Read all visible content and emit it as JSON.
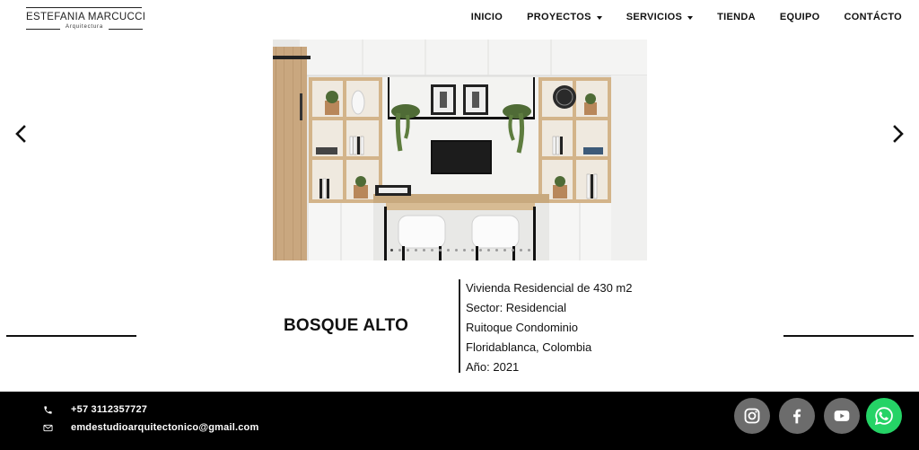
{
  "brand": {
    "name": "ESTEFANIA MARCUCCI",
    "tagline": "Arquitectura"
  },
  "nav": {
    "items": [
      {
        "label": "INICIO",
        "dropdown": false
      },
      {
        "label": "PROYECTOS",
        "dropdown": true
      },
      {
        "label": "SERVICIOS",
        "dropdown": true
      },
      {
        "label": "TIENDA",
        "dropdown": false
      },
      {
        "label": "EQUIPO",
        "dropdown": false
      },
      {
        "label": "CONTÁCTO",
        "dropdown": false
      }
    ]
  },
  "carousel": {
    "prev_icon": "chevron-left-icon",
    "next_icon": "chevron-right-icon",
    "slide_count": 18,
    "active_index": 0
  },
  "project": {
    "title": "BOSQUE ALTO",
    "details": [
      "Vivienda Residencial de 430 m2",
      "Sector:  Residencial",
      "Ruitoque Condominio",
      "Floridablanca, Colombia",
      "Año: 2021"
    ]
  },
  "footer": {
    "phone": "+57 3112357727",
    "email": "emdestudioarquitectonico@gmail.com",
    "phone_icon": "phone-icon",
    "email_icon": "envelope-icon",
    "social": [
      {
        "name": "instagram-icon",
        "color": "#6c6c6c"
      },
      {
        "name": "facebook-icon",
        "color": "#6c6c6c"
      },
      {
        "name": "youtube-icon",
        "color": "#6c6c6c"
      },
      {
        "name": "whatsapp-icon",
        "color": "#25d366"
      }
    ]
  }
}
